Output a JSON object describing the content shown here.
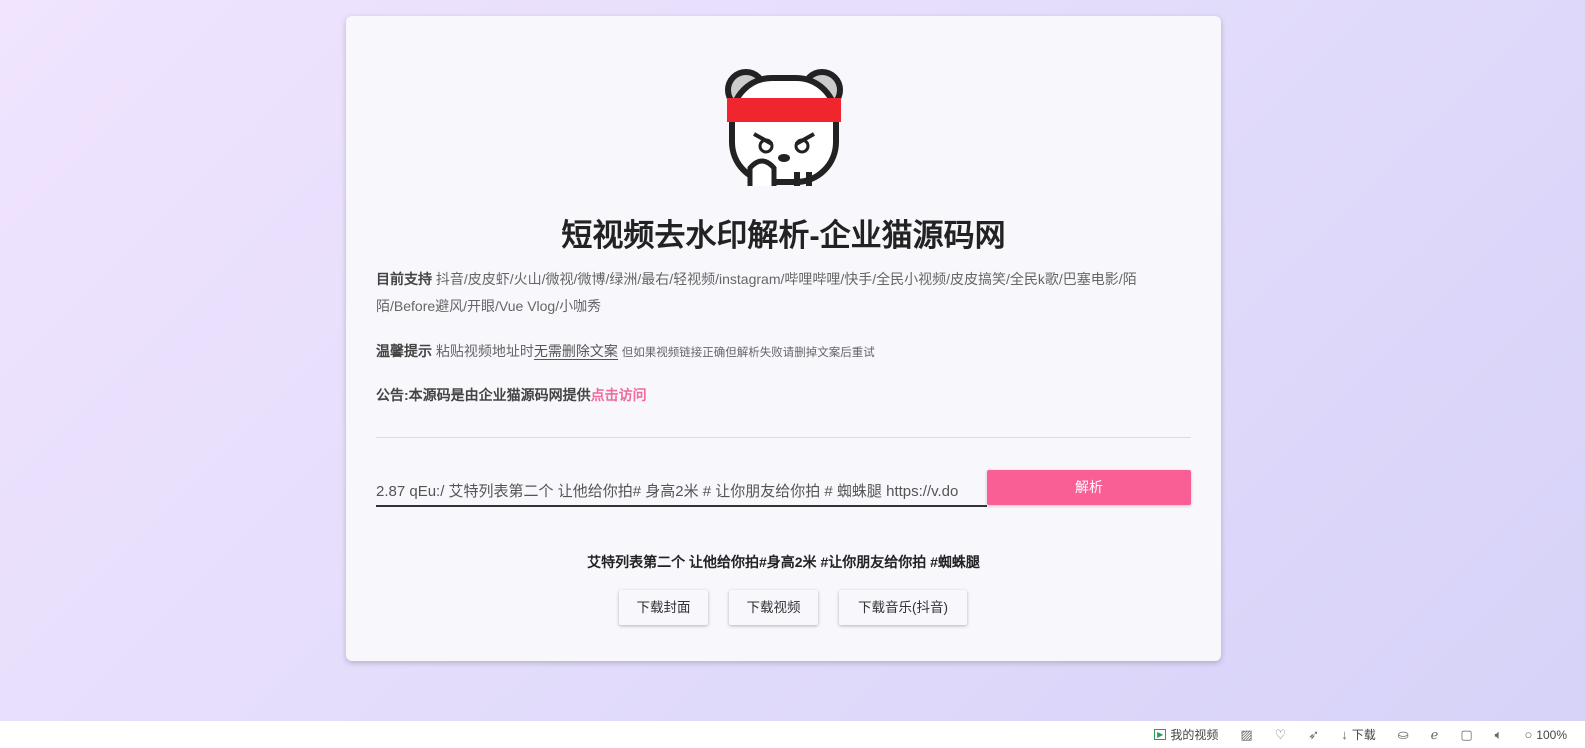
{
  "title": "短视频去水印解析-企业猫源码网",
  "support": {
    "label": "目前支持",
    "text": "抖音/皮皮虾/火山/微视/微博/绿洲/最右/轻视频/instagram/哔哩哔哩/快手/全民小视频/皮皮搞笑/全民k歌/巴塞电影/陌陌/Before避风/开眼/Vue Vlog/小咖秀"
  },
  "tip": {
    "label": "温馨提示",
    "text": "粘贴视频地址时",
    "underlined": "无需删除文案",
    "small": "但如果视频链接正确但解析失败请删掉文案后重试"
  },
  "notice": {
    "text": "公告:本源码是由企业猫源码网提供",
    "link": "点击访问"
  },
  "input": {
    "value": "2.87 qEu:/ 艾特列表第二个 让他给你拍# 身高2米 # 让你朋友给你拍 # 蜘蛛腿 https://v.do"
  },
  "parse_button": "解析",
  "video_title": "艾特列表第二个 让他给你拍#身高2米 #让你朋友给你拍 #蜘蛛腿",
  "buttons": [
    "下载封面",
    "下载视频",
    "下载音乐(抖音)"
  ],
  "statusbar": {
    "my_video": "我的视频",
    "download": "下载",
    "zoom": "100%"
  },
  "colors": {
    "accent": "#f95f94",
    "link": "#f06a9b"
  }
}
